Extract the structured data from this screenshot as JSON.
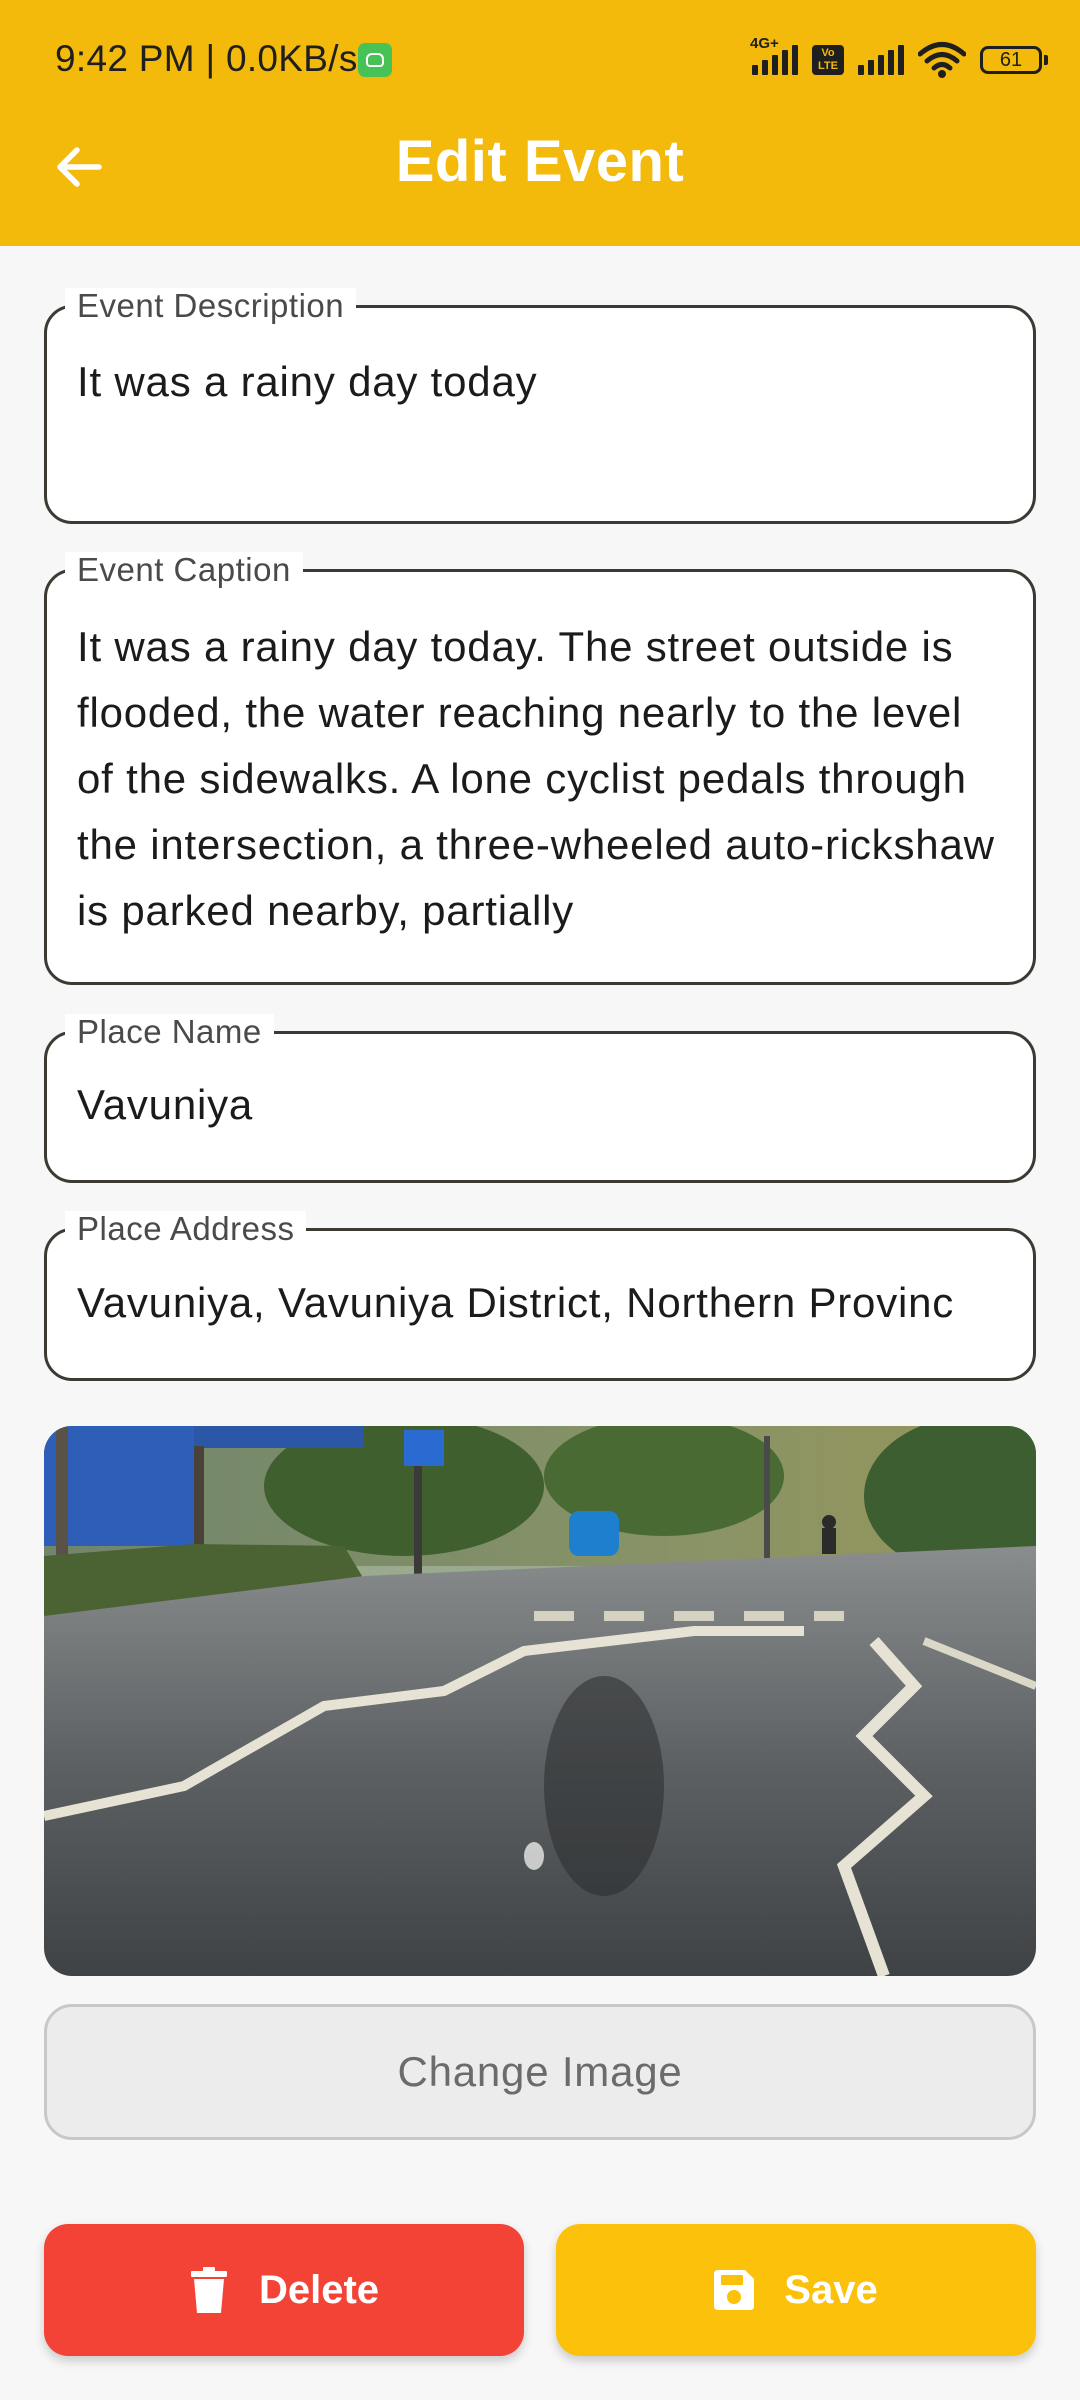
{
  "status_bar": {
    "time": "9:42 PM | 0.0KB/s",
    "network_type": "4G+",
    "volte": "Vo LTE",
    "battery": "61"
  },
  "header": {
    "title": "Edit Event",
    "back_icon": "arrow-left-icon"
  },
  "form": {
    "description": {
      "label": "Event Description",
      "value": "It was a rainy day today"
    },
    "caption": {
      "label": "Event Caption",
      "value": "It was a rainy day today.  The street outside is flooded, the water reaching nearly to the level of the sidewalks.  A lone cyclist pedals through the intersection,  a three-wheeled auto-rickshaw is parked nearby, partially"
    },
    "place_name": {
      "label": "Place Name",
      "value": "Vavuniya"
    },
    "place_address": {
      "label": "Place Address",
      "value": "Vavuniya, Vavuniya District, Northern Provinc"
    }
  },
  "image": {
    "icon": "photo-icon"
  },
  "buttons": {
    "change_image": "Change Image",
    "delete": "Delete",
    "delete_icon": "trash-icon",
    "save": "Save",
    "save_icon": "floppy-disk-icon"
  },
  "colors": {
    "app_bar": "#f3b90b",
    "delete": "#f34336",
    "save": "#fcc10a"
  }
}
